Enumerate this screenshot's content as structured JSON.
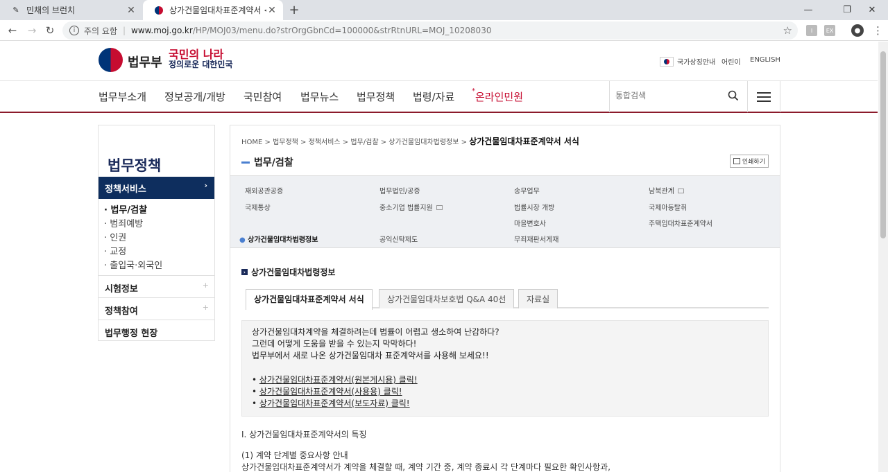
{
  "browser": {
    "tabs": [
      {
        "label": "민채의 브런치",
        "icon": "brunch-pen-icon"
      },
      {
        "label": "상가건물임대차표준계약서 < 상",
        "icon": "moj-emblem-icon"
      }
    ],
    "security_label": "주의 요함",
    "url_host": "www.moj.go.kr",
    "url_rest": "/HP/MOJ03/menu.do?strOrgGbnCd=100000&strRtnURL=MOJ_10208030",
    "ext1": "I",
    "ext2": "EX"
  },
  "header": {
    "logo_text": "법무부",
    "slogan_line1": "국민의 나라",
    "slogan_line2": "정의로운 대한민국",
    "util": [
      "국가상징안내",
      "어린이",
      "ENGLISH"
    ]
  },
  "gnb": {
    "items": [
      "법무부소개",
      "정보공개/개방",
      "국민참여",
      "법무뉴스",
      "법무정책",
      "법령/자료"
    ],
    "online": "온라인민원",
    "online_mark": "*",
    "search_placeholder": "통합검색"
  },
  "lnb": {
    "title": "법무정책",
    "active": "정책서비스",
    "subs": [
      "· 법무/검찰",
      "· 범죄예방",
      "· 인권",
      "· 교정",
      "· 출입국·외국인"
    ],
    "groups": [
      "시험정보",
      "정책참여",
      "법무행정 현장"
    ]
  },
  "content": {
    "breadcrumb": "HOME  >  법무정책  >  정책서비스  >  법무/검찰  >  상가건물임대차법령정보  > ",
    "breadcrumb_last": "상가건물임대차표준계약서 서식",
    "section_title": "법무/검찰",
    "print_label": "인쇄하기",
    "submenu": [
      "재외공관공증",
      "법무법인/공증",
      "송무업무",
      "남북관계",
      "국제통상",
      "중소기업 법률지원",
      "법률시장 개방",
      "국제아동탈취",
      "마을변호사",
      "주택임대차표준계약서",
      "상가건물임대차법령정보",
      "공익신탁제도",
      "무죄재판서게재"
    ],
    "h3": "상가건물임대차법령정보",
    "tabs": [
      "상가건물임대차표준계약서 서식",
      "상가건물임대차보호법 Q&A 40선",
      "자료실"
    ],
    "notice_lines": [
      "상가건물임대차계약을 체결하려는데 법률이 어렵고 생소하여 난감하다?",
      "그런데 어떻게 도움을 받을 수 있는지 막막하다!",
      "법무부에서 새로 나온 상가건물임대차 표준계약서를 사용해 보세요!!"
    ],
    "bullet": "•",
    "links": [
      "상가건물임대차표준계약서(원본게시용) 클릭!",
      "상가건물임대차표준계약서(사용용) 클릭!",
      "상가건물임대차표준계약서(보도자료) 클릭!"
    ],
    "section1": "Ⅰ. 상가건물임대차표준계약서의 특징",
    "sub1": "(1) 계약 단계별 중요사항 안내",
    "sub1_text": "상가건물임대차표준계약서가 계약을 체결할 때, 계약 기간 중, 계약 종료시 각 단계마다 필요한 확인사항과,"
  }
}
